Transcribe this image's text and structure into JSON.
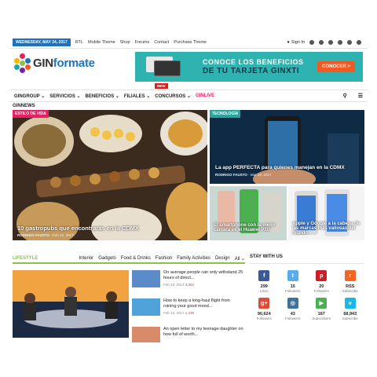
{
  "topbar": {
    "date": "WEDNESDAY, MAY 24, 2017",
    "links": [
      "RTL",
      "Mobile Theme",
      "Shop",
      "Forums",
      "Contact",
      "Purchase Theme"
    ],
    "signin": "Sign In"
  },
  "logo": {
    "part1": "GIN",
    "part2": "formate"
  },
  "banner": {
    "line1": "CONOCE LOS BENEFICIOS",
    "line2": "DE TU TARJETA GINXTI",
    "cta": "CONOCER >"
  },
  "nav": {
    "items": [
      "GINGROUP ⌄",
      "SERVICIOS ⌄",
      "BENEFICIOS ⌄",
      "FILIALES ⌄",
      "CONCURSOS ⌄"
    ],
    "live": "GINLIVE",
    "new_badge": "NEW",
    "sub": "GINNEWS"
  },
  "hero": {
    "tag": "ESTILO DE VIDA",
    "tag_color": "#e91e63",
    "title": "10 gastropubs que encontrarás en la CDMX",
    "author": "RODRIGO FAUSTO",
    "date": "- Feb 24, 2017"
  },
  "right_top": {
    "tag": "TECNOLOGÍA",
    "tag_color": "#26a69a",
    "title": "La app PERFECTA para quienes manejan en la CDMX",
    "author": "RODRIGO FAUSTO",
    "date": "- Mar 26, 2017"
  },
  "right_bl": {
    "title": "El smartphone con la mejor cámara es el Huawei P10"
  },
  "right_br": {
    "title": "Apple y Google a la cabeza de las marcas más valiosas del mundo"
  },
  "lifestyle": {
    "title": "LIFESTYLE",
    "cats": [
      "Interior",
      "Gadgets",
      "Food & Drinks",
      "Fashion",
      "Family Activities",
      "Design",
      "All ⌄"
    ]
  },
  "posts": [
    {
      "title": "On average people can only withstand 25 hours of direct...",
      "date": "Feb 23, 2017",
      "count": "3,052"
    },
    {
      "title": "How to keep a long-haul flight from ruining your good mood...",
      "date": "Feb 13, 2017",
      "count": "1,439"
    },
    {
      "title": "An open letter to my teenage daughter on how full of worth...",
      "date": "",
      "count": ""
    }
  ],
  "stay": {
    "title": "STAY WITH US",
    "items": [
      {
        "icon": "facebook-icon",
        "glyph": "f",
        "color": "#3b5998",
        "count": "299",
        "label": "Likes"
      },
      {
        "icon": "twitter-icon",
        "glyph": "t",
        "color": "#55acee",
        "count": "15",
        "label": "Followers"
      },
      {
        "icon": "pinterest-icon",
        "glyph": "p",
        "color": "#cb2027",
        "count": "20",
        "label": "Followers"
      },
      {
        "icon": "rss-icon",
        "glyph": "r",
        "color": "#f26522",
        "count": "RSS",
        "label": "Subscribe"
      },
      {
        "icon": "googleplus-icon",
        "glyph": "g+",
        "color": "#dd4b39",
        "count": "90,624",
        "label": "Followers"
      },
      {
        "icon": "instagram-icon",
        "glyph": "◎",
        "color": "#3f729b",
        "count": "43",
        "label": "Followers"
      },
      {
        "icon": "youtube-icon",
        "glyph": "▶",
        "color": "#4caf50",
        "count": "167",
        "label": "Subscribers"
      },
      {
        "icon": "vimeo-icon",
        "glyph": "v",
        "color": "#1ab7ea",
        "count": "68,943",
        "label": "Subscribe"
      }
    ]
  }
}
